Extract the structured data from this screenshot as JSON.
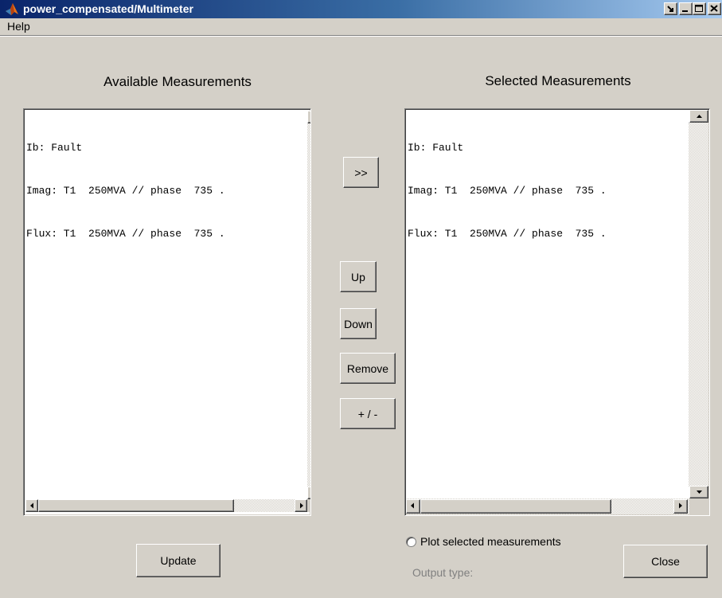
{
  "window": {
    "title": "power_compensated/Multimeter",
    "icon": "matlab-icon"
  },
  "menu": {
    "help_label": "Help"
  },
  "available": {
    "header": "Available Measurements",
    "items": [
      "Ib: Fault",
      "Imag: T1  250MVA // phase  735 .",
      "Flux: T1  250MVA // phase  735 ."
    ]
  },
  "selected": {
    "header": "Selected Measurements",
    "items": [
      "Ib: Fault",
      "Imag: T1  250MVA // phase  735 .",
      "Flux: T1  250MVA // phase  735 ."
    ]
  },
  "buttons": {
    "add": ">>",
    "up": "Up",
    "down": "Down",
    "remove": "Remove",
    "sign": "+ / -",
    "update": "Update",
    "close": "Close"
  },
  "options": {
    "plot_label": "Plot selected measurements",
    "plot_checked": false,
    "output_type_label": "Output type:"
  },
  "colors": {
    "titlebar_start": "#0a246a",
    "titlebar_end": "#a6caf0",
    "face": "#d4d0c8",
    "disabled_text": "#808080"
  }
}
